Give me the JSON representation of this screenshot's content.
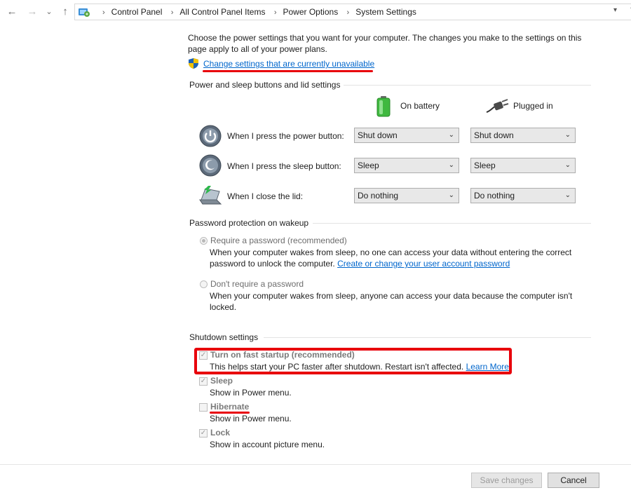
{
  "nav": {
    "back_icon": "←",
    "forward_icon": "→",
    "recent_icon": "⌄",
    "up_icon": "↑",
    "refresh_icon": "↻"
  },
  "breadcrumb": [
    "Control Panel",
    "All Control Panel Items",
    "Power Options",
    "System Settings"
  ],
  "intro": {
    "line1": "Choose the power settings that you want for your computer. The changes you make to the settings on this",
    "line2": "page apply to all of your power plans.",
    "change_link": "Change settings that are currently unavailable"
  },
  "buttons_section": {
    "title": "Power and sleep buttons and lid settings",
    "on_battery": "On battery",
    "plugged_in": "Plugged in",
    "rows": [
      {
        "label": "When I press the power button:",
        "battery": "Shut down",
        "plugged": "Shut down"
      },
      {
        "label": "When I press the sleep button:",
        "battery": "Sleep",
        "plugged": "Sleep"
      },
      {
        "label": "When I close the lid:",
        "battery": "Do nothing",
        "plugged": "Do nothing"
      }
    ]
  },
  "password_section": {
    "title": "Password protection on wakeup",
    "require_label": "Require a password (recommended)",
    "require_desc1": "When your computer wakes from sleep, no one can access your data without entering the correct",
    "require_desc2": "password to unlock the computer.",
    "require_link": "Create or change your user account password",
    "norequire_label": "Don't require a password",
    "norequire_desc1": "When your computer wakes from sleep, anyone can access your data because the computer isn't",
    "norequire_desc2": "locked."
  },
  "shutdown_section": {
    "title": "Shutdown settings",
    "items": [
      {
        "label": "Turn on fast startup (recommended)",
        "desc": "This helps start your PC faster after shutdown. Restart isn't affected.",
        "checked": true
      },
      {
        "label": "Sleep",
        "desc": "Show in Power menu.",
        "checked": true
      },
      {
        "label": "Hibernate",
        "desc": "Show in Power menu.",
        "checked": false
      },
      {
        "label": "Lock",
        "desc": "Show in account picture menu.",
        "checked": true
      }
    ],
    "learn_more": "Learn More"
  },
  "footer": {
    "save": "Save changes",
    "cancel": "Cancel"
  },
  "colors": {
    "annotation_red": "#e8000b",
    "link_blue": "#0066cc"
  }
}
